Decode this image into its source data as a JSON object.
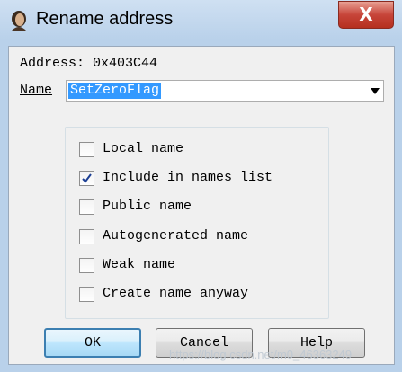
{
  "window": {
    "title": "Rename address",
    "close_label": "X"
  },
  "address": {
    "text": "Address: 0x403C44"
  },
  "name_field": {
    "label": "Name",
    "value": "SetZeroFlag"
  },
  "options": [
    {
      "label": "Local name",
      "checked": false
    },
    {
      "label": "Include in names list",
      "checked": true
    },
    {
      "label": "Public name",
      "checked": false
    },
    {
      "label": "Autogenerated name",
      "checked": false
    },
    {
      "label": "Weak name",
      "checked": false
    },
    {
      "label": "Create name anyway",
      "checked": false
    }
  ],
  "buttons": {
    "ok": "OK",
    "cancel": "Cancel",
    "help": "Help"
  },
  "watermark": "https://blog.csdn.net/m0_46363249",
  "colors": {
    "selection": "#3399ff",
    "frame": "#b9d1ea",
    "close": "#c7453a"
  }
}
